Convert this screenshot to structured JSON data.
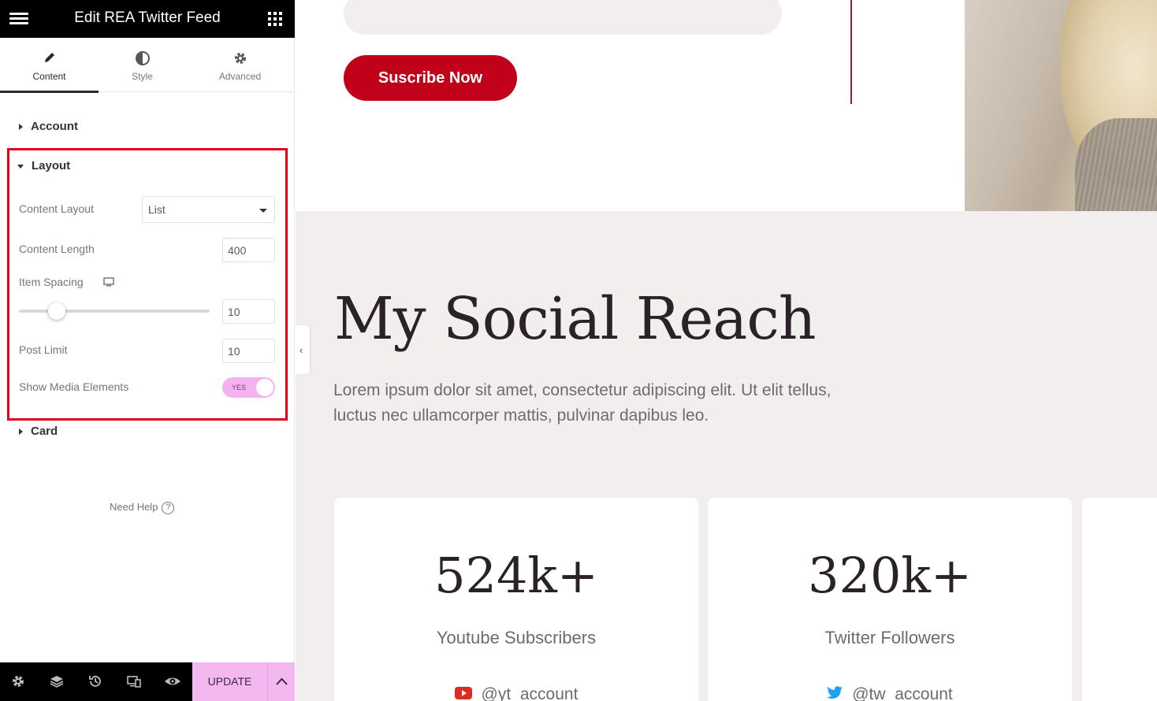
{
  "panel": {
    "title": "Edit REA Twitter Feed",
    "tabs": [
      {
        "label": "Content",
        "icon": "pencil-icon"
      },
      {
        "label": "Style",
        "icon": "half-circle-icon"
      },
      {
        "label": "Advanced",
        "icon": "gear-icon"
      }
    ],
    "sections": {
      "account": "Account",
      "layout": "Layout",
      "card": "Card"
    },
    "layout": {
      "content_layout_label": "Content Layout",
      "content_layout_value": "List",
      "content_length_label": "Content Length",
      "content_length_value": "400",
      "item_spacing_label": "Item Spacing",
      "item_spacing_value": "10",
      "post_limit_label": "Post Limit",
      "post_limit_value": "10",
      "show_media_label": "Show Media Elements",
      "show_media_toggle": "YES"
    },
    "need_help": "Need Help",
    "footer": {
      "update_label": "UPDATE"
    },
    "colors": {
      "highlight_border": "#e2001a",
      "update_bg": "#f3b8f0"
    }
  },
  "preview": {
    "subscribe_button": "Suscribe Now",
    "section_title": "My Social Reach",
    "section_text": "Lorem ipsum dolor sit amet, consectetur adipiscing elit. Ut elit tellus, luctus nec ullamcorper mattis, pulvinar dapibus leo.",
    "cards": [
      {
        "count": "524k+",
        "label": "Youtube Subscribers",
        "handle": "@yt_account",
        "icon": "youtube-icon"
      },
      {
        "count": "320k+",
        "label": "Twitter Followers",
        "handle": "@tw_account",
        "icon": "twitter-icon"
      }
    ],
    "colors": {
      "brand_red": "#c10019",
      "section_bg": "#f3eeee"
    }
  }
}
